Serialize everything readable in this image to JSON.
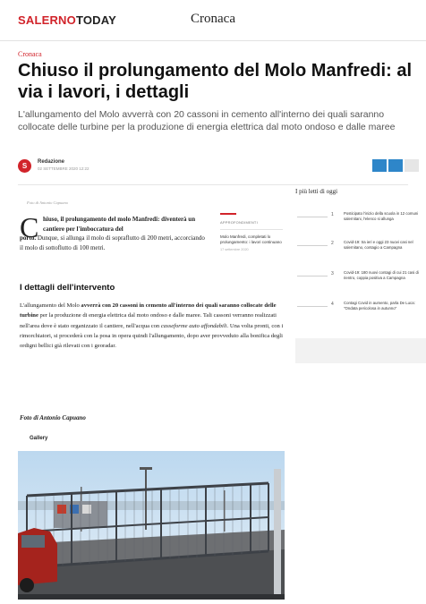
{
  "header": {
    "logo_part1": "SALERNO",
    "logo_part2": "TODAY",
    "section": "Cronaca"
  },
  "article": {
    "kicker": "Cronaca",
    "title": "Chiuso il prolungamento del Molo Manfredi: al via i lavori, i dettagli",
    "subtitle": "L'allungamento del Molo avverrà con 20 cassoni in cemento all'interno dei quali saranno collocate delle turbine per la produzione di energia elettrica dal moto ondoso e dalle maree",
    "author_initial": "S",
    "author": "Redazione",
    "date": "02 SETTEMBRE 2020 12:22",
    "photo_caption_top": "Foto di Antonio Capuano",
    "lead_dropcap": "C",
    "lead_bold_1": "hiuso, il prolungamento del molo Manfredi: diventerà un cantiere per l'imboccatura del",
    "lead_bold_2": "porto.",
    "lead_rest": " Dunque, si allunga il molo di sopraflutto di 200 metri, accorciando il molo di sottoflutto di 100 metri.",
    "section_heading": "I dettagli dell'intervento",
    "body_1": "L'allungamento del Molo ",
    "body_bold_1": "avverrà con 20 cassoni in cemento all'interno dei quali saranno collocate delle turbine",
    "body_2": " per la produzione di energia elettrica dal moto ondoso e dalle maree. Tali cassoni verranno realizzati nell'area dove è stato organizzato il cantiere, nell'acqua con ",
    "body_italic": "casseforme auto affondabili",
    "body_3": ". Una volta pronti, con i rimorchiatori, si procederà con la posa in opera quindi l'allungamento, dopo aver provveduto alla bonifica degli ordigni bellici già rilevati con i georadar.",
    "photo_credit": "Foto di Antonio Capuano",
    "gallery_label": "Gallery"
  },
  "related": {
    "kicker": "APPROFONDIMENTI",
    "title": "Molo Manfredi, completati lo prolungamento: i lavori continuano",
    "date": "17 settembre 2020"
  },
  "sidebar": {
    "title": "I più letti di oggi",
    "items": [
      {
        "num": "1",
        "text": "Posticipato l'inizio della scuola in 12 comuni salernitani, l'elenco si allunga"
      },
      {
        "num": "2",
        "text": "Covid-19: tra ieri e oggi 23 nuovi casi nel salernitano, contagio a Campagna"
      },
      {
        "num": "3",
        "text": "Covid-19: 180 nuovi contagi di cui 21 casi di rientro, coppia positiva a Campagna"
      },
      {
        "num": "4",
        "text": "Contagi Covid in aumento, parla De Luca: \"Ondata pericolosa in autunno\""
      }
    ]
  },
  "colors": {
    "brand_red": "#d1232a",
    "share_blue": "#2e86c9"
  }
}
